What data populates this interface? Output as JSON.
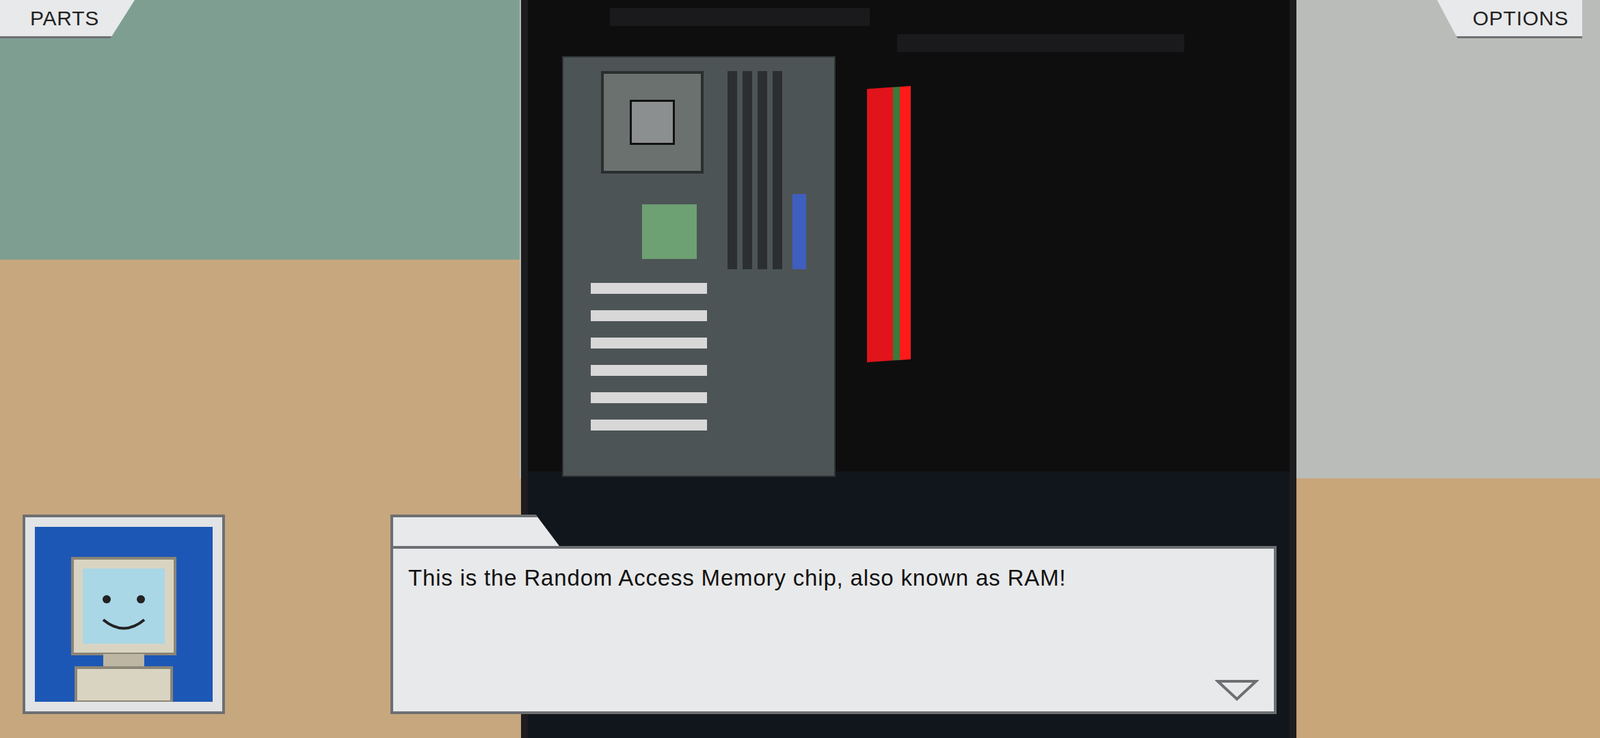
{
  "hud": {
    "buttons": [
      {
        "label": "PARTS",
        "side": "left"
      },
      {
        "label": "OPTIONS",
        "side": "right"
      }
    ]
  },
  "dialog": {
    "text": "This is the Random Access Memory chip, also known as RAM!"
  }
}
